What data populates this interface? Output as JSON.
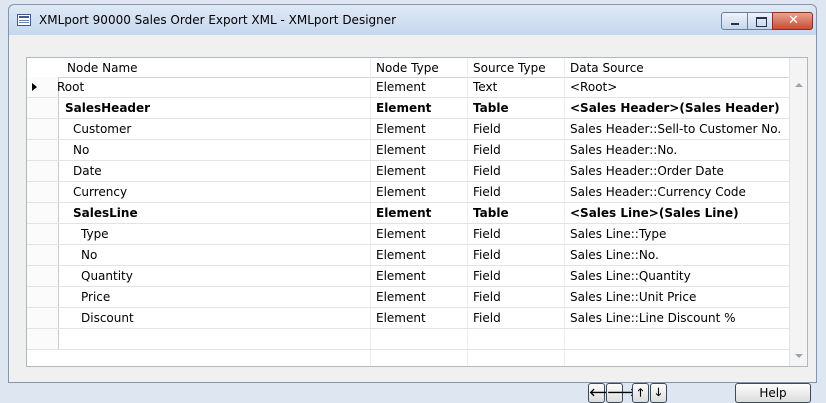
{
  "window": {
    "title": "XMLport 90000 Sales Order Export XML - XMLport Designer",
    "minimize_glyph": "",
    "close_glyph": "✕"
  },
  "grid": {
    "columns": [
      "Node Name",
      "Node Type",
      "Source Type",
      "Data Source"
    ],
    "rows": [
      {
        "name": "Root",
        "type": "Element",
        "source_type": "Text",
        "source": "<Root>",
        "indent": 0,
        "bold": false,
        "current": true
      },
      {
        "name": "SalesHeader",
        "type": "Element",
        "source_type": "Table",
        "source": "<Sales Header>(Sales Header)",
        "indent": 1,
        "bold": true,
        "current": false
      },
      {
        "name": "Customer",
        "type": "Element",
        "source_type": "Field",
        "source": "Sales Header::Sell-to Customer No.",
        "indent": 2,
        "bold": false,
        "current": false
      },
      {
        "name": "No",
        "type": "Element",
        "source_type": "Field",
        "source": "Sales Header::No.",
        "indent": 2,
        "bold": false,
        "current": false
      },
      {
        "name": "Date",
        "type": "Element",
        "source_type": "Field",
        "source": "Sales Header::Order Date",
        "indent": 2,
        "bold": false,
        "current": false
      },
      {
        "name": "Currency",
        "type": "Element",
        "source_type": "Field",
        "source": "Sales Header::Currency Code",
        "indent": 2,
        "bold": false,
        "current": false
      },
      {
        "name": "SalesLine",
        "type": "Element",
        "source_type": "Table",
        "source": "<Sales Line>(Sales Line)",
        "indent": 2,
        "bold": true,
        "current": false
      },
      {
        "name": "Type",
        "type": "Element",
        "source_type": "Field",
        "source": "Sales Line::Type",
        "indent": 3,
        "bold": false,
        "current": false
      },
      {
        "name": "No",
        "type": "Element",
        "source_type": "Field",
        "source": "Sales Line::No.",
        "indent": 3,
        "bold": false,
        "current": false
      },
      {
        "name": "Quantity",
        "type": "Element",
        "source_type": "Field",
        "source": "Sales Line::Quantity",
        "indent": 3,
        "bold": false,
        "current": false
      },
      {
        "name": "Price",
        "type": "Element",
        "source_type": "Field",
        "source": "Sales Line::Unit Price",
        "indent": 3,
        "bold": false,
        "current": false
      },
      {
        "name": "Discount",
        "type": "Element",
        "source_type": "Field",
        "source": "Sales Line::Line Discount %",
        "indent": 3,
        "bold": false,
        "current": false
      },
      {
        "name": "",
        "type": "",
        "source_type": "",
        "source": "",
        "indent": 0,
        "bold": false,
        "current": false
      }
    ]
  },
  "buttons": {
    "left_arrow": "🡐",
    "right_arrow": "🡒",
    "up_arrow": "🡑",
    "down_arrow": "🡓",
    "help": "Help"
  }
}
